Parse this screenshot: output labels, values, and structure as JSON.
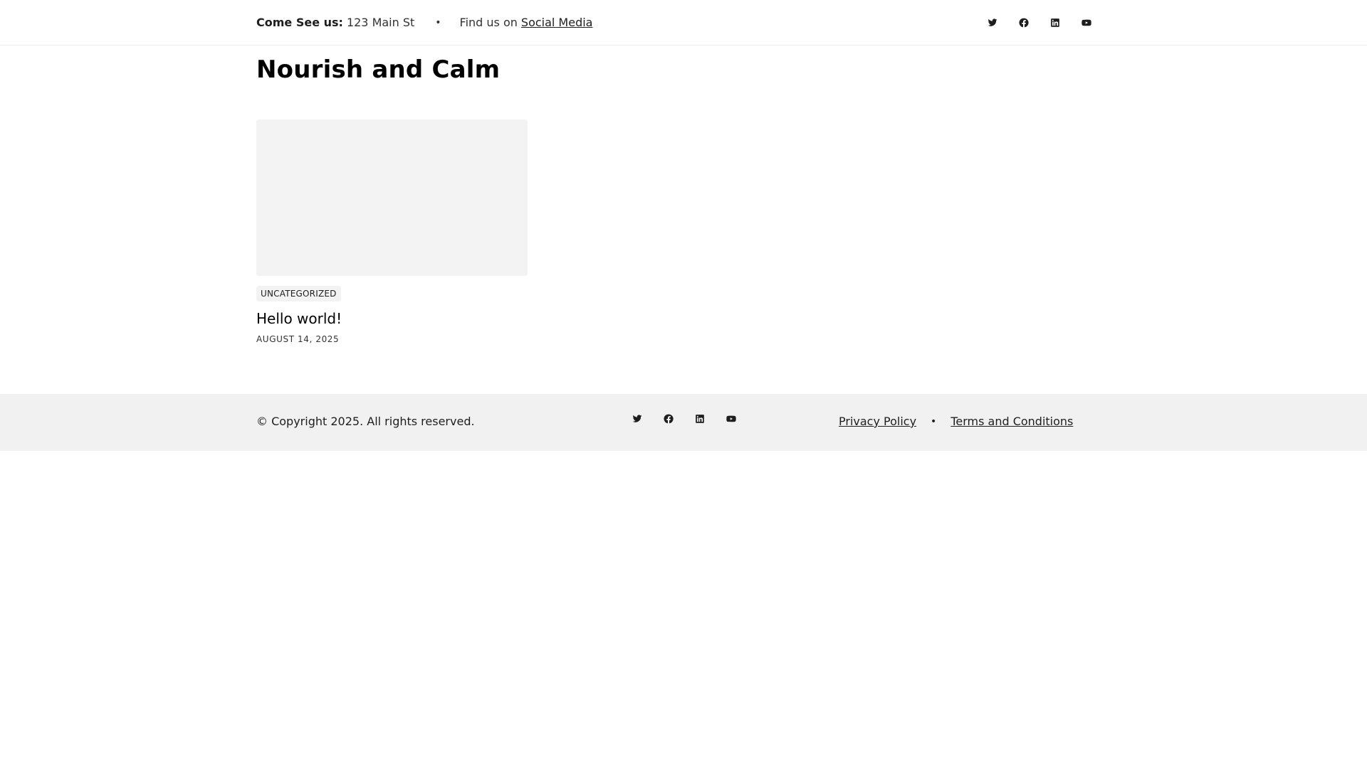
{
  "topbar": {
    "address_label": "Come See us:",
    "address_value": "123 Main St",
    "separator": "•",
    "find_us_text": "Find us on",
    "social_link": "Social Media",
    "social_icons": [
      "twitter-icon",
      "facebook-icon",
      "linkedin-icon",
      "youtube-icon"
    ]
  },
  "site": {
    "title": "Nourish and Calm"
  },
  "posts": [
    {
      "category": "UNCATEGORIZED",
      "title": "Hello world!",
      "date": "AUGUST 14, 2025"
    }
  ],
  "footer": {
    "copyright": "© Copyright 2025. All rights reserved.",
    "separator": "•",
    "privacy": "Privacy Policy",
    "terms": "Terms and Conditions",
    "social_icons": [
      "twitter-icon",
      "facebook-icon",
      "linkedin-icon",
      "youtube-icon"
    ]
  },
  "colors": {
    "thumb_bg": "#f3f3f3",
    "footer_bg": "#f1f1f1",
    "text": "#1e1e1e"
  }
}
